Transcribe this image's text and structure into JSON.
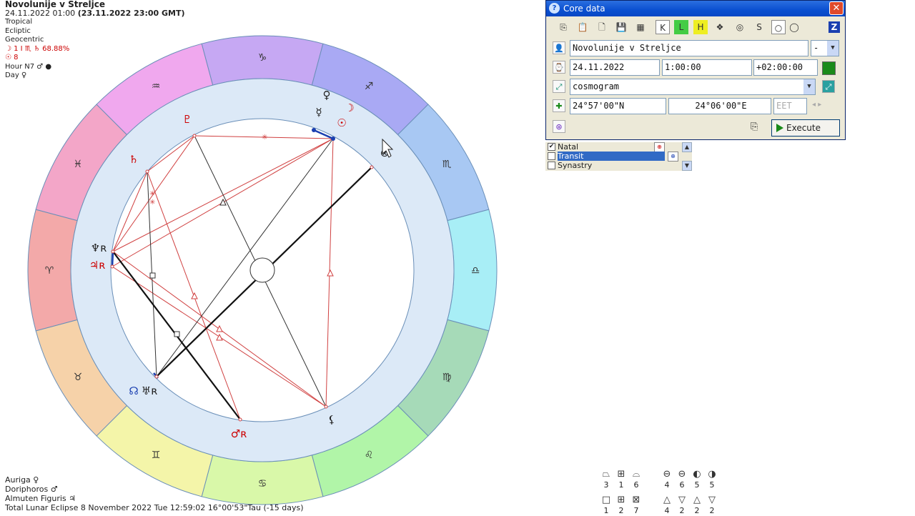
{
  "header": {
    "title": "Novolunije v Streljce",
    "date_local": "24.11.2022  01:00",
    "date_gmt": "(23.11.2022  23:00 GMT)",
    "zodiac": "Tropical",
    "coords": "Ecliptic",
    "center": "Geocentric",
    "moon_line": "☽  1 I ♏ ♄ 68.88%",
    "sun_line": "☉  8",
    "hour_line": "Hour N7 ♂ ●",
    "day_line": "Day ♀"
  },
  "footer": {
    "auriga": "Auriga  ♀",
    "doriphoros": "Doriphoros  ♂",
    "almuten": "Almuten Figuris  ♃",
    "eclipse": "Total Lunar Eclipse 8 November 2022 Tue 12:59:02 16°00'53\"Tau (-15 days)"
  },
  "wheel": {
    "signs": [
      {
        "glyph": "♑",
        "color": "#c6a8f3"
      },
      {
        "glyph": "♐",
        "color": "#a9a9f4"
      },
      {
        "glyph": "♏",
        "color": "#a8c8f3"
      },
      {
        "glyph": "♎",
        "color": "#a8eef6"
      },
      {
        "glyph": "♍",
        "color": "#a6dab8"
      },
      {
        "glyph": "♌",
        "color": "#b1f5a8"
      },
      {
        "glyph": "♋",
        "color": "#d9f8a9"
      },
      {
        "glyph": "♊",
        "color": "#f4f5a9"
      },
      {
        "glyph": "♉",
        "color": "#f6d2a9"
      },
      {
        "glyph": "♈",
        "color": "#f3a9a9"
      },
      {
        "glyph": "♓",
        "color": "#f3a6c8"
      },
      {
        "glyph": "♒",
        "color": "#f0a8ee"
      }
    ],
    "planets": [
      {
        "name": "venus",
        "glyph": "♀",
        "color": "#222"
      },
      {
        "name": "mercury",
        "glyph": "☿",
        "color": "#222"
      },
      {
        "name": "moon",
        "glyph": "☽",
        "color": "#c00"
      },
      {
        "name": "sun",
        "glyph": "☉",
        "color": "#c00"
      },
      {
        "name": "pluto",
        "glyph": "♇",
        "color": "#c00"
      },
      {
        "name": "saturn",
        "glyph": "♄",
        "color": "#c00"
      },
      {
        "name": "neptune",
        "glyph": "♆ʀ",
        "color": "#222"
      },
      {
        "name": "jupiter",
        "glyph": "♃ʀ",
        "color": "#c00"
      },
      {
        "name": "node",
        "glyph": "☊",
        "color": "#1a3fb0"
      },
      {
        "name": "uranus",
        "glyph": "♅ʀ",
        "color": "#222"
      },
      {
        "name": "mars",
        "glyph": "♂ʀ",
        "color": "#c00"
      },
      {
        "name": "lilith",
        "glyph": "⚸",
        "color": "#222"
      },
      {
        "name": "fortune",
        "glyph": "⊗",
        "color": "#222"
      }
    ],
    "colors": {
      "ring": "#dce9f7",
      "line_red": "#d04040",
      "line_black": "#111",
      "line_blue": "#1a3fb0"
    }
  },
  "window": {
    "title": "Core data",
    "close": "✕",
    "toolbar": [
      "⎘",
      "📋",
      "🗋",
      "💾",
      "▦",
      "K",
      "L",
      "H",
      "❖",
      "◎",
      "S",
      "○",
      "◯",
      "Z"
    ],
    "name_value": "Novolunije v Strelјce",
    "name_sel": "-",
    "date_value": "24.11.2022",
    "time_value": "1:00:00",
    "tz_value": "+02:00:00",
    "type_value": "cosmogram",
    "lat_value": "24°57'00\"N",
    "lon_value": "24°06'00\"E",
    "zone_value": "EET",
    "execute": "Execute",
    "colors": {
      "green": "#1a8a1a",
      "title_bg": "#0a4fd0"
    }
  },
  "list": {
    "items": [
      {
        "label": "Natal",
        "checked": "✔"
      },
      {
        "label": "Transit",
        "checked": ""
      },
      {
        "label": "Synastry",
        "checked": ""
      }
    ]
  },
  "aspects": {
    "row1": [
      {
        "glyph": "⏢",
        "num": "3"
      },
      {
        "glyph": "⊞",
        "num": "1"
      },
      {
        "glyph": "⌓",
        "num": "6"
      },
      {
        "glyph": "⊖",
        "num": "4"
      },
      {
        "glyph": "⊖",
        "num": "6"
      },
      {
        "glyph": "◐",
        "num": "5"
      },
      {
        "glyph": "◑",
        "num": "5"
      }
    ],
    "row2": [
      {
        "glyph": "□",
        "num": "1"
      },
      {
        "glyph": "⊞",
        "num": "2"
      },
      {
        "glyph": "⊠",
        "num": "7"
      },
      {
        "glyph": "△",
        "num": "4"
      },
      {
        "glyph": "▽",
        "num": "2"
      },
      {
        "glyph": "△",
        "num": "2"
      },
      {
        "glyph": "▽",
        "num": "2"
      }
    ]
  }
}
